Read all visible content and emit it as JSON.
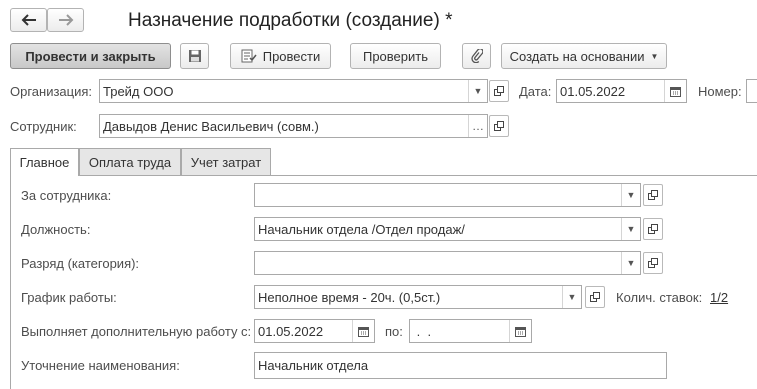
{
  "window": {
    "title": "Назначение подработки (создание) *"
  },
  "nav": {
    "back_glyph": "🡐",
    "forward_glyph": "🡒"
  },
  "toolbar": {
    "post_and_close": "Провести и закрыть",
    "post": "Провести",
    "check": "Проверить",
    "create_based_on": "Создать на основании"
  },
  "header": {
    "org_label": "Организация:",
    "org_value": "Трейд ООО",
    "date_label": "Дата:",
    "date_value": "01.05.2022",
    "number_label": "Номер:",
    "employee_label": "Сотрудник:",
    "employee_value": "Давыдов Денис Васильевич (совм.)"
  },
  "tabs": [
    {
      "label": "Главное"
    },
    {
      "label": "Оплата труда"
    },
    {
      "label": "Учет затрат"
    }
  ],
  "main": {
    "for_employee_label": "За сотрудника:",
    "for_employee_value": "",
    "position_label": "Должность:",
    "position_value": "Начальник отдела /Отдел продаж/",
    "grade_label": "Разряд (категория):",
    "grade_value": "",
    "schedule_label": "График работы:",
    "schedule_value": "Неполное время - 20ч. (0,5ст.)",
    "rate_count_label": "Колич. ставок:",
    "rate_count_value": "1/2",
    "performs_label": "Выполняет дополнительную работу с:",
    "performs_from": "01.05.2022",
    "to_label": "по:",
    "performs_to": " .  .",
    "clarification_label": "Уточнение наименования:",
    "clarification_value": "Начальник отдела"
  },
  "colors": {
    "link": "#333333",
    "border": "#a9a9a9"
  }
}
